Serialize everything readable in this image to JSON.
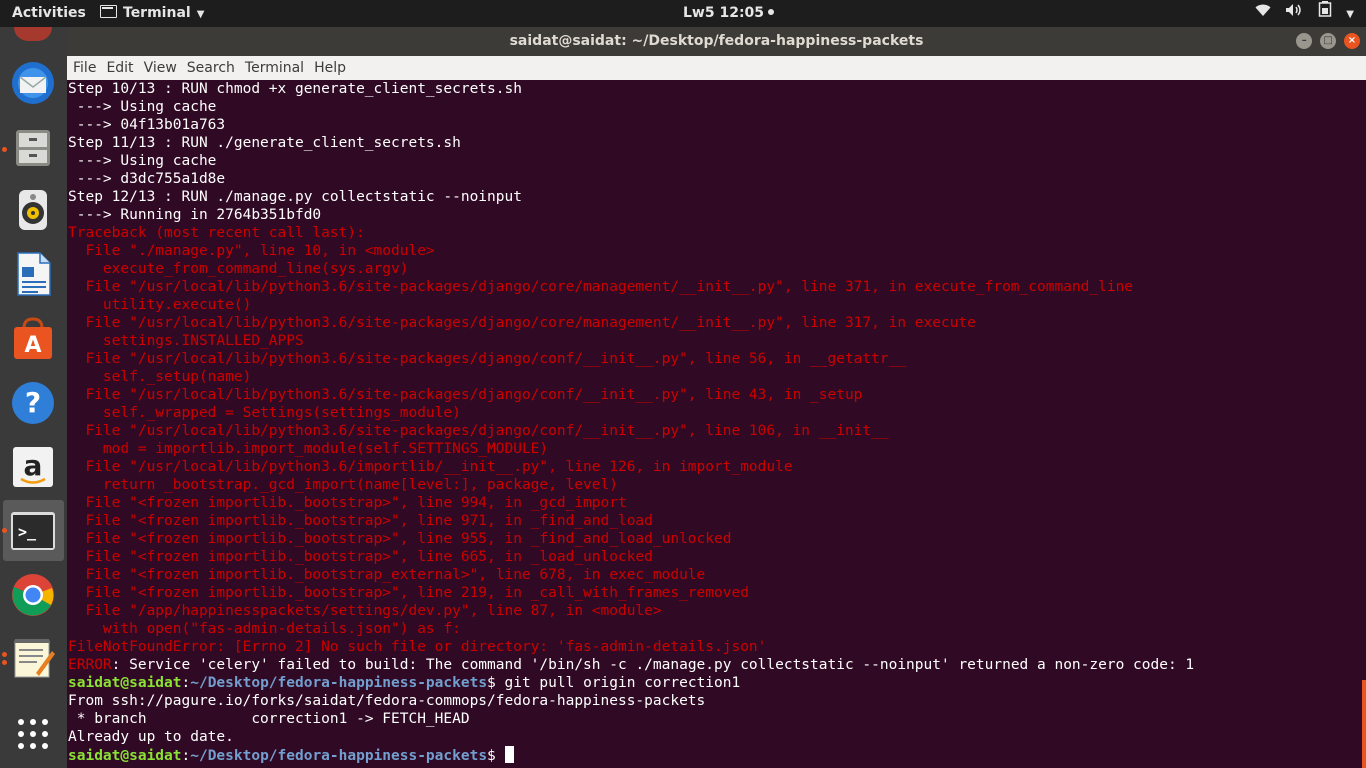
{
  "topbar": {
    "activities": "Activities",
    "app_name": "Terminal",
    "clock": "Lw5 12:05",
    "tray_icons": [
      "wifi-icon",
      "volume-icon",
      "battery-icon",
      "power-icon"
    ]
  },
  "dock": {
    "items": [
      "thunderbird-mail",
      "files",
      "rhythmbox",
      "libreoffice-writer",
      "ubuntu-software",
      "help",
      "amazon",
      "terminal",
      "chrome",
      "text-editor",
      "show-applications"
    ],
    "amazon_glyph": "a",
    "help_glyph": "?",
    "terminal_glyph": ">_"
  },
  "window": {
    "title": "saidat@saidat: ~/Desktop/fedora-happiness-packets",
    "menu": [
      "File",
      "Edit",
      "View",
      "Search",
      "Terminal",
      "Help"
    ]
  },
  "terminal": {
    "lines": [
      {
        "text": "Step 10/13 : RUN chmod +x generate_client_secrets.sh",
        "color": "white"
      },
      {
        "text": " ---> Using cache",
        "color": "white"
      },
      {
        "text": " ---> 04f13b01a763",
        "color": "white"
      },
      {
        "text": "Step 11/13 : RUN ./generate_client_secrets.sh",
        "color": "white"
      },
      {
        "text": " ---> Using cache",
        "color": "white"
      },
      {
        "text": " ---> d3dc755a1d8e",
        "color": "white"
      },
      {
        "text": "Step 12/13 : RUN ./manage.py collectstatic --noinput",
        "color": "white"
      },
      {
        "text": " ---> Running in 2764b351bfd0",
        "color": "white"
      },
      {
        "text": "Traceback (most recent call last):",
        "color": "red"
      },
      {
        "text": "  File \"./manage.py\", line 10, in <module>",
        "color": "red"
      },
      {
        "text": "    execute_from_command_line(sys.argv)",
        "color": "red"
      },
      {
        "text": "  File \"/usr/local/lib/python3.6/site-packages/django/core/management/__init__.py\", line 371, in execute_from_command_line",
        "color": "red"
      },
      {
        "text": "    utility.execute()",
        "color": "red"
      },
      {
        "text": "  File \"/usr/local/lib/python3.6/site-packages/django/core/management/__init__.py\", line 317, in execute",
        "color": "red"
      },
      {
        "text": "    settings.INSTALLED_APPS",
        "color": "red"
      },
      {
        "text": "  File \"/usr/local/lib/python3.6/site-packages/django/conf/__init__.py\", line 56, in __getattr__",
        "color": "red"
      },
      {
        "text": "    self._setup(name)",
        "color": "red"
      },
      {
        "text": "  File \"/usr/local/lib/python3.6/site-packages/django/conf/__init__.py\", line 43, in _setup",
        "color": "red"
      },
      {
        "text": "    self._wrapped = Settings(settings_module)",
        "color": "red"
      },
      {
        "text": "  File \"/usr/local/lib/python3.6/site-packages/django/conf/__init__.py\", line 106, in __init__",
        "color": "red"
      },
      {
        "text": "    mod = importlib.import_module(self.SETTINGS_MODULE)",
        "color": "red"
      },
      {
        "text": "  File \"/usr/local/lib/python3.6/importlib/__init__.py\", line 126, in import_module",
        "color": "red"
      },
      {
        "text": "    return _bootstrap._gcd_import(name[level:], package, level)",
        "color": "red"
      },
      {
        "text": "  File \"<frozen importlib._bootstrap>\", line 994, in _gcd_import",
        "color": "red"
      },
      {
        "text": "  File \"<frozen importlib._bootstrap>\", line 971, in _find_and_load",
        "color": "red"
      },
      {
        "text": "  File \"<frozen importlib._bootstrap>\", line 955, in _find_and_load_unlocked",
        "color": "red"
      },
      {
        "text": "  File \"<frozen importlib._bootstrap>\", line 665, in _load_unlocked",
        "color": "red"
      },
      {
        "text": "  File \"<frozen importlib._bootstrap_external>\", line 678, in exec_module",
        "color": "red"
      },
      {
        "text": "  File \"<frozen importlib._bootstrap>\", line 219, in _call_with_frames_removed",
        "color": "red"
      },
      {
        "text": "  File \"/app/happinesspackets/settings/dev.py\", line 87, in <module>",
        "color": "red"
      },
      {
        "text": "    with open(\"fas-admin-details.json\") as f:",
        "color": "red"
      },
      {
        "text": "FileNotFoundError: [Errno 2] No such file or directory: 'fas-admin-details.json'",
        "color": "red"
      }
    ],
    "error_line": {
      "label": "ERROR",
      "message": ": Service 'celery' failed to build: The command '/bin/sh -c ./manage.py collectstatic --noinput' returned a non-zero code: 1"
    },
    "prompt1": {
      "user": "saidat@saidat",
      "sep": ":",
      "path": "~/Desktop/fedora-happiness-packets",
      "symbol": "$ ",
      "command": "git pull origin correction1"
    },
    "after_lines": [
      "From ssh://pagure.io/forks/saidat/fedora-commops/fedora-happiness-packets",
      " * branch            correction1 -> FETCH_HEAD",
      "Already up to date."
    ],
    "prompt2": {
      "user": "saidat@saidat",
      "sep": ":",
      "path": "~/Desktop/fedora-happiness-packets",
      "symbol": "$ "
    }
  },
  "colors": {
    "terminal_bg": "#300a24",
    "error_red": "#cc0000",
    "prompt_green": "#8ae234",
    "prompt_blue": "#729fcf",
    "accent": "#e95420"
  }
}
